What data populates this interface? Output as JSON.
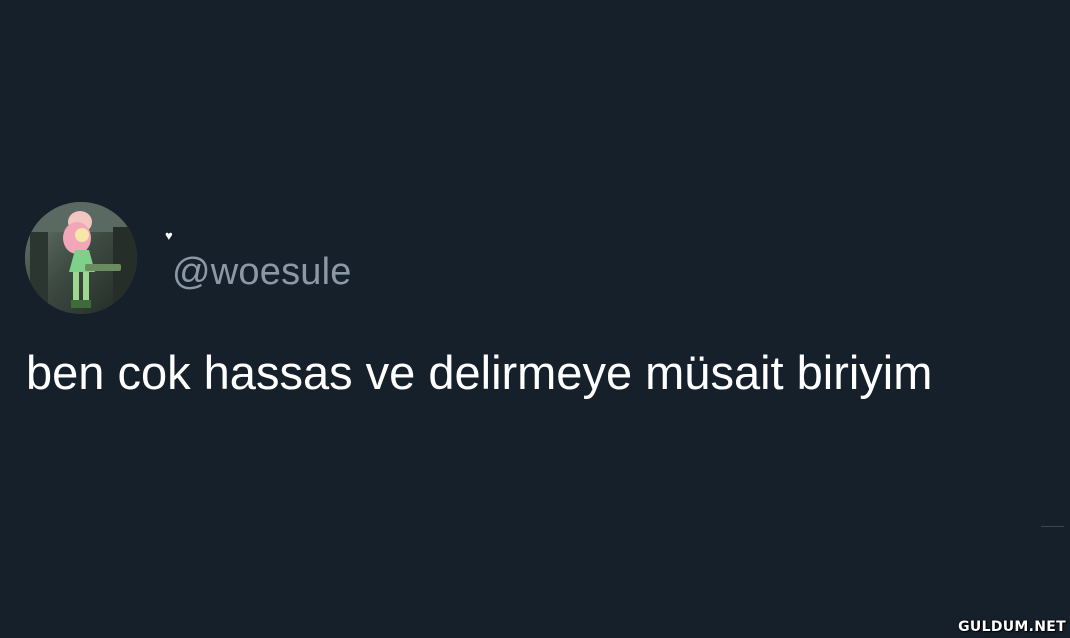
{
  "profile": {
    "display_name": "♥",
    "handle": "@woesule",
    "avatar_icon": "avatar-image"
  },
  "tweet": {
    "text": "ben cok hassas ve delirmeye müsait biriyim"
  },
  "watermark": {
    "text": "GULDUM.NET"
  },
  "colors": {
    "background": "#16202b",
    "text_primary": "#ffffff",
    "text_secondary": "#8b98a5"
  }
}
